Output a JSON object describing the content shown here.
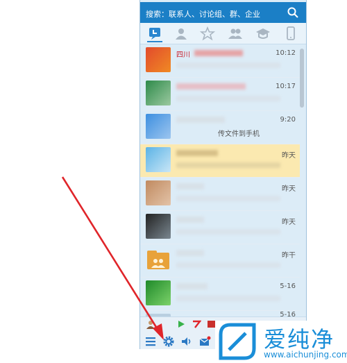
{
  "search": {
    "placeholder": "搜索：联系人、讨论组、群、企业"
  },
  "tabs": [
    "recent-icon",
    "contacts-icon",
    "favorites-icon",
    "groups-icon",
    "hat-icon",
    "phone-icon"
  ],
  "conversations": [
    {
      "name": "四川",
      "time": "10:12",
      "preview": ""
    },
    {
      "name": "",
      "time": "10:17",
      "preview": ""
    },
    {
      "name": "",
      "time": "9:20",
      "preview": "传文件到手机"
    },
    {
      "name": "",
      "time": "昨天",
      "preview": ""
    },
    {
      "name": "",
      "time": "昨天",
      "preview": ""
    },
    {
      "name": "",
      "time": "昨天",
      "preview": ""
    },
    {
      "name": "",
      "time": "昨干",
      "preview": ""
    },
    {
      "name": "",
      "time": "5-16",
      "preview": ""
    },
    {
      "name": "",
      "time": "5-16",
      "preview": ""
    }
  ],
  "watermark": {
    "brand": "爱纯净",
    "url": "www.aichunjing.com"
  },
  "colors": {
    "accent": "#1b7fc6",
    "arrow": "#e0252a"
  }
}
